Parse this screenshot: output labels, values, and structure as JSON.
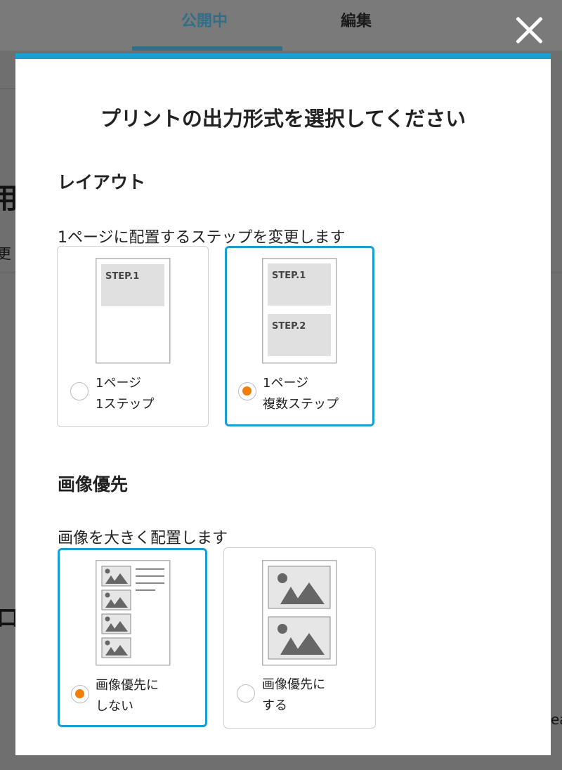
{
  "tabs": {
    "published": "公開中",
    "edit": "編集"
  },
  "background": {
    "frag1": "用",
    "frag2": "更",
    "frag3": "ロ",
    "frag4": "ea"
  },
  "modal": {
    "title": "プリントの出力形式を選択してください",
    "layout": {
      "title": "レイアウト",
      "description": "1ページに配置するステップを変更します",
      "options": [
        {
          "line1": "1ページ",
          "line2": "1ステップ",
          "selected": false,
          "steps": [
            "STEP.1"
          ]
        },
        {
          "line1": "1ページ",
          "line2": "複数ステップ",
          "selected": true,
          "steps": [
            "STEP.1",
            "STEP.2"
          ]
        }
      ]
    },
    "image_priority": {
      "title": "画像優先",
      "description": "画像を大きく配置します",
      "options": [
        {
          "line1": "画像優先に",
          "line2": "しない",
          "selected": true
        },
        {
          "line1": "画像優先に",
          "line2": "する",
          "selected": false
        }
      ]
    }
  },
  "colors": {
    "accent": "#1aa0d0",
    "radio_selected": "#f47d08",
    "tab_active": "#2f6f8a"
  },
  "icons": {
    "close": "close-icon",
    "image": "image-placeholder-icon"
  }
}
